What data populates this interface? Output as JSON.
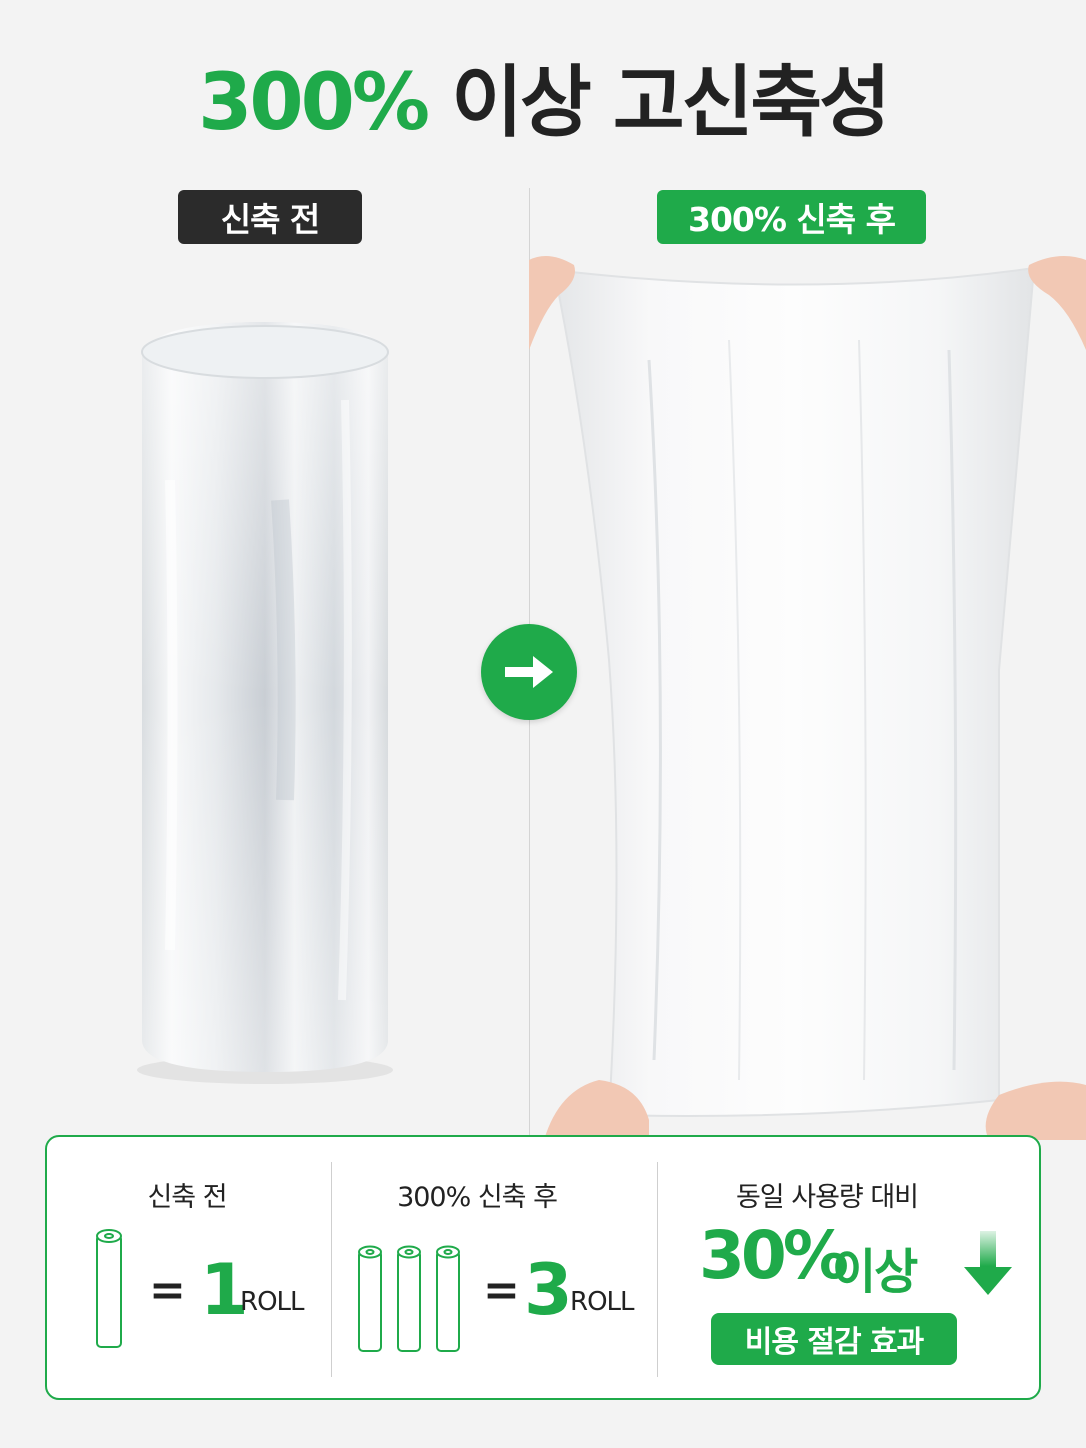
{
  "headline": {
    "accent": "300%",
    "rest": "이상 고신축성"
  },
  "before_badge": "신축 전",
  "after_badge": "300% 신축 후",
  "comparison": {
    "col1": {
      "label": "신축 전",
      "equals": "=",
      "value": "1",
      "unit": "ROLL"
    },
    "col2": {
      "label": "300% 신축 후",
      "equals": "=",
      "value": "3",
      "unit": "ROLL"
    },
    "col3": {
      "label": "동일 사용량 대비",
      "percent": "30%",
      "percent_suffix": "이상",
      "badge": "비용 절감 효과"
    }
  },
  "colors": {
    "accent": "#1faa4a",
    "dark": "#2b2b2b"
  },
  "icons": [
    "arrow-right-icon",
    "roll-icon",
    "arrow-down-icon"
  ]
}
